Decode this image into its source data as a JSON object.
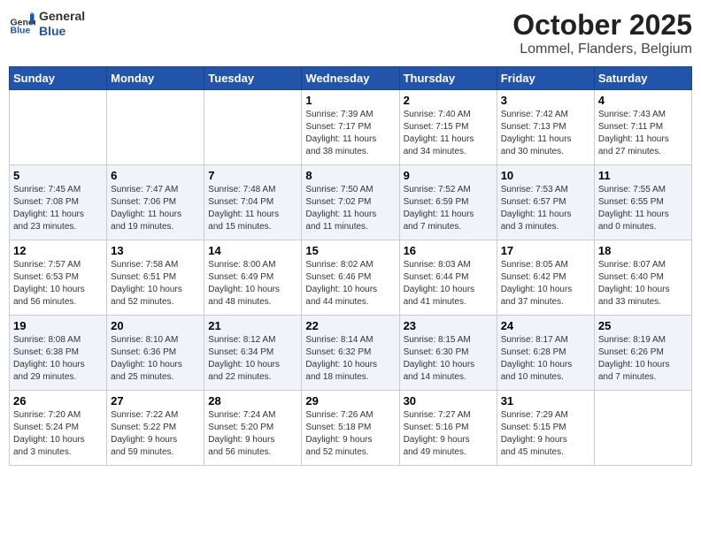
{
  "header": {
    "logo_general": "General",
    "logo_blue": "Blue",
    "month": "October 2025",
    "location": "Lommel, Flanders, Belgium"
  },
  "days_of_week": [
    "Sunday",
    "Monday",
    "Tuesday",
    "Wednesday",
    "Thursday",
    "Friday",
    "Saturday"
  ],
  "weeks": [
    [
      {
        "day": "",
        "info": ""
      },
      {
        "day": "",
        "info": ""
      },
      {
        "day": "",
        "info": ""
      },
      {
        "day": "1",
        "info": "Sunrise: 7:39 AM\nSunset: 7:17 PM\nDaylight: 11 hours\nand 38 minutes."
      },
      {
        "day": "2",
        "info": "Sunrise: 7:40 AM\nSunset: 7:15 PM\nDaylight: 11 hours\nand 34 minutes."
      },
      {
        "day": "3",
        "info": "Sunrise: 7:42 AM\nSunset: 7:13 PM\nDaylight: 11 hours\nand 30 minutes."
      },
      {
        "day": "4",
        "info": "Sunrise: 7:43 AM\nSunset: 7:11 PM\nDaylight: 11 hours\nand 27 minutes."
      }
    ],
    [
      {
        "day": "5",
        "info": "Sunrise: 7:45 AM\nSunset: 7:08 PM\nDaylight: 11 hours\nand 23 minutes."
      },
      {
        "day": "6",
        "info": "Sunrise: 7:47 AM\nSunset: 7:06 PM\nDaylight: 11 hours\nand 19 minutes."
      },
      {
        "day": "7",
        "info": "Sunrise: 7:48 AM\nSunset: 7:04 PM\nDaylight: 11 hours\nand 15 minutes."
      },
      {
        "day": "8",
        "info": "Sunrise: 7:50 AM\nSunset: 7:02 PM\nDaylight: 11 hours\nand 11 minutes."
      },
      {
        "day": "9",
        "info": "Sunrise: 7:52 AM\nSunset: 6:59 PM\nDaylight: 11 hours\nand 7 minutes."
      },
      {
        "day": "10",
        "info": "Sunrise: 7:53 AM\nSunset: 6:57 PM\nDaylight: 11 hours\nand 3 minutes."
      },
      {
        "day": "11",
        "info": "Sunrise: 7:55 AM\nSunset: 6:55 PM\nDaylight: 11 hours\nand 0 minutes."
      }
    ],
    [
      {
        "day": "12",
        "info": "Sunrise: 7:57 AM\nSunset: 6:53 PM\nDaylight: 10 hours\nand 56 minutes."
      },
      {
        "day": "13",
        "info": "Sunrise: 7:58 AM\nSunset: 6:51 PM\nDaylight: 10 hours\nand 52 minutes."
      },
      {
        "day": "14",
        "info": "Sunrise: 8:00 AM\nSunset: 6:49 PM\nDaylight: 10 hours\nand 48 minutes."
      },
      {
        "day": "15",
        "info": "Sunrise: 8:02 AM\nSunset: 6:46 PM\nDaylight: 10 hours\nand 44 minutes."
      },
      {
        "day": "16",
        "info": "Sunrise: 8:03 AM\nSunset: 6:44 PM\nDaylight: 10 hours\nand 41 minutes."
      },
      {
        "day": "17",
        "info": "Sunrise: 8:05 AM\nSunset: 6:42 PM\nDaylight: 10 hours\nand 37 minutes."
      },
      {
        "day": "18",
        "info": "Sunrise: 8:07 AM\nSunset: 6:40 PM\nDaylight: 10 hours\nand 33 minutes."
      }
    ],
    [
      {
        "day": "19",
        "info": "Sunrise: 8:08 AM\nSunset: 6:38 PM\nDaylight: 10 hours\nand 29 minutes."
      },
      {
        "day": "20",
        "info": "Sunrise: 8:10 AM\nSunset: 6:36 PM\nDaylight: 10 hours\nand 25 minutes."
      },
      {
        "day": "21",
        "info": "Sunrise: 8:12 AM\nSunset: 6:34 PM\nDaylight: 10 hours\nand 22 minutes."
      },
      {
        "day": "22",
        "info": "Sunrise: 8:14 AM\nSunset: 6:32 PM\nDaylight: 10 hours\nand 18 minutes."
      },
      {
        "day": "23",
        "info": "Sunrise: 8:15 AM\nSunset: 6:30 PM\nDaylight: 10 hours\nand 14 minutes."
      },
      {
        "day": "24",
        "info": "Sunrise: 8:17 AM\nSunset: 6:28 PM\nDaylight: 10 hours\nand 10 minutes."
      },
      {
        "day": "25",
        "info": "Sunrise: 8:19 AM\nSunset: 6:26 PM\nDaylight: 10 hours\nand 7 minutes."
      }
    ],
    [
      {
        "day": "26",
        "info": "Sunrise: 7:20 AM\nSunset: 5:24 PM\nDaylight: 10 hours\nand 3 minutes."
      },
      {
        "day": "27",
        "info": "Sunrise: 7:22 AM\nSunset: 5:22 PM\nDaylight: 9 hours\nand 59 minutes."
      },
      {
        "day": "28",
        "info": "Sunrise: 7:24 AM\nSunset: 5:20 PM\nDaylight: 9 hours\nand 56 minutes."
      },
      {
        "day": "29",
        "info": "Sunrise: 7:26 AM\nSunset: 5:18 PM\nDaylight: 9 hours\nand 52 minutes."
      },
      {
        "day": "30",
        "info": "Sunrise: 7:27 AM\nSunset: 5:16 PM\nDaylight: 9 hours\nand 49 minutes."
      },
      {
        "day": "31",
        "info": "Sunrise: 7:29 AM\nSunset: 5:15 PM\nDaylight: 9 hours\nand 45 minutes."
      },
      {
        "day": "",
        "info": ""
      }
    ]
  ]
}
